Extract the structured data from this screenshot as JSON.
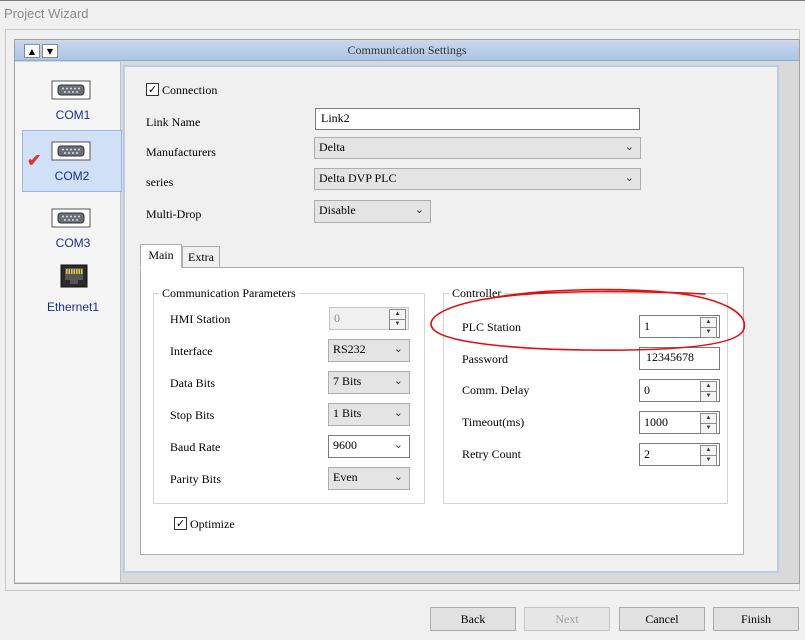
{
  "window": {
    "title": "Project Wizard"
  },
  "header": {
    "title": "Communication Settings"
  },
  "sidebar": {
    "items": [
      {
        "label": "COM1",
        "icon": "serial-port-icon"
      },
      {
        "label": "COM2",
        "icon": "serial-port-icon",
        "selected": true,
        "checked_mark": "✔"
      },
      {
        "label": "COM3",
        "icon": "serial-port-icon"
      },
      {
        "label": "Ethernet1",
        "icon": "ethernet-port-icon"
      }
    ]
  },
  "connection": {
    "checkbox_label": "Connection",
    "checked": true,
    "link_name_label": "Link Name",
    "link_name_value": "Link2",
    "manufacturers_label": "Manufacturers",
    "manufacturers_value": "Delta",
    "series_label": "series",
    "series_value": "Delta DVP PLC",
    "multidrop_label": "Multi-Drop",
    "multidrop_value": "Disable"
  },
  "tabs": [
    {
      "label": "Main",
      "active": true
    },
    {
      "label": "Extra",
      "active": false
    }
  ],
  "comm_params": {
    "title": "Communication Parameters",
    "hmi_station_label": "HMI Station",
    "hmi_station_value": "0",
    "interface_label": "Interface",
    "interface_value": "RS232",
    "data_bits_label": "Data Bits",
    "data_bits_value": "7 Bits",
    "stop_bits_label": "Stop Bits",
    "stop_bits_value": "1 Bits",
    "baud_rate_label": "Baud Rate",
    "baud_rate_value": "9600",
    "parity_bits_label": "Parity Bits",
    "parity_bits_value": "Even"
  },
  "controller": {
    "title": "Controller",
    "plc_station_label": "PLC Station",
    "plc_station_value": "1",
    "password_label": "Password",
    "password_value": "12345678",
    "comm_delay_label": "Comm. Delay",
    "comm_delay_value": "0",
    "timeout_label": "Timeout(ms)",
    "timeout_value": "1000",
    "retry_count_label": "Retry Count",
    "retry_count_value": "2"
  },
  "optimize": {
    "label": "Optimize",
    "checked": true
  },
  "buttons": {
    "back": "Back",
    "next": "Next",
    "cancel": "Cancel",
    "finish": "Finish"
  },
  "colors": {
    "annotation": "#e01010",
    "header": "#b8cde9",
    "selected": "#cfe0f7"
  }
}
